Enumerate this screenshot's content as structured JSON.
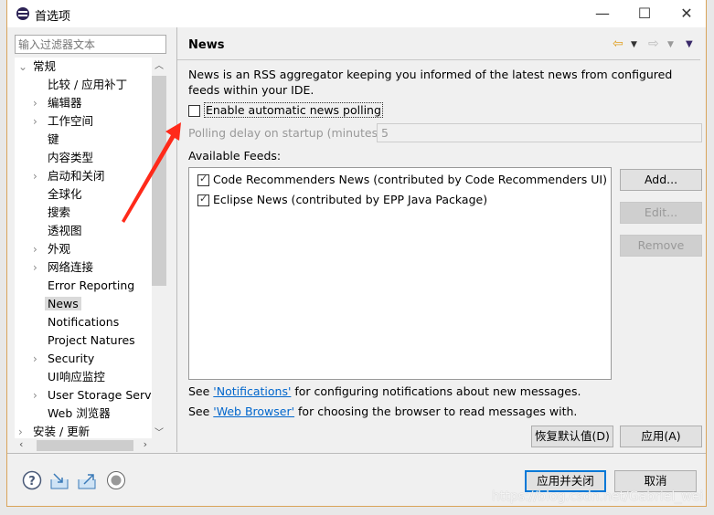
{
  "window": {
    "title": "首选项",
    "minimize": "—",
    "maximize": "☐",
    "close": "✕"
  },
  "filter": {
    "placeholder": "输入过滤器文本"
  },
  "tree": [
    {
      "label": "常规",
      "level": 0,
      "expand": "open"
    },
    {
      "label": "比较 / 应用补丁",
      "level": 1,
      "expand": "none"
    },
    {
      "label": "编辑器",
      "level": 1,
      "expand": "closed"
    },
    {
      "label": "工作空间",
      "level": 1,
      "expand": "closed"
    },
    {
      "label": "键",
      "level": 1,
      "expand": "none"
    },
    {
      "label": "内容类型",
      "level": 1,
      "expand": "none"
    },
    {
      "label": "启动和关闭",
      "level": 1,
      "expand": "closed"
    },
    {
      "label": "全球化",
      "level": 1,
      "expand": "none"
    },
    {
      "label": "搜索",
      "level": 1,
      "expand": "none"
    },
    {
      "label": "透视图",
      "level": 1,
      "expand": "none"
    },
    {
      "label": "外观",
      "level": 1,
      "expand": "closed"
    },
    {
      "label": "网络连接",
      "level": 1,
      "expand": "closed"
    },
    {
      "label": "Error Reporting",
      "level": 1,
      "expand": "none"
    },
    {
      "label": "News",
      "level": 1,
      "expand": "none",
      "selected": true
    },
    {
      "label": "Notifications",
      "level": 1,
      "expand": "none"
    },
    {
      "label": "Project Natures",
      "level": 1,
      "expand": "none"
    },
    {
      "label": "Security",
      "level": 1,
      "expand": "closed"
    },
    {
      "label": "UI响应监控",
      "level": 1,
      "expand": "none"
    },
    {
      "label": "User Storage Servic",
      "level": 1,
      "expand": "closed"
    },
    {
      "label": "Web 浏览器",
      "level": 1,
      "expand": "none"
    },
    {
      "label": "安装 / 更新",
      "level": 0,
      "expand": "closed"
    }
  ],
  "panel": {
    "title": "News",
    "description": "News is an RSS aggregator keeping you informed of the latest news from configured feeds within your IDE.",
    "polling_checkbox": {
      "label": "Enable automatic news polling",
      "checked": false
    },
    "delay": {
      "label": "Polling delay on startup (minutes):",
      "value": "5"
    },
    "feeds_label": "Available Feeds:",
    "feeds": [
      {
        "label": "Code Recommenders News (contributed by Code Recommenders UI)",
        "checked": true
      },
      {
        "label": "Eclipse News (contributed by EPP Java Package)",
        "checked": true
      }
    ],
    "add": "Add...",
    "edit": "Edit...",
    "remove": "Remove",
    "see1": {
      "pre": "See ",
      "link": "'Notifications'",
      "post": " for configuring notifications about new messages."
    },
    "see2": {
      "pre": "See ",
      "link": "'Web Browser'",
      "post": " for choosing the browser to read messages with."
    },
    "restore": "恢复默认值(D)",
    "apply": "应用(A)"
  },
  "footer": {
    "apply_close": "应用并关闭",
    "cancel": "取消"
  },
  "watermark": "https://blog.csdn.net/Gabriel_wei",
  "colors": {
    "accent": "#0078d7",
    "link": "#0066cc",
    "annotation_arrow": "#ff2a1a"
  }
}
